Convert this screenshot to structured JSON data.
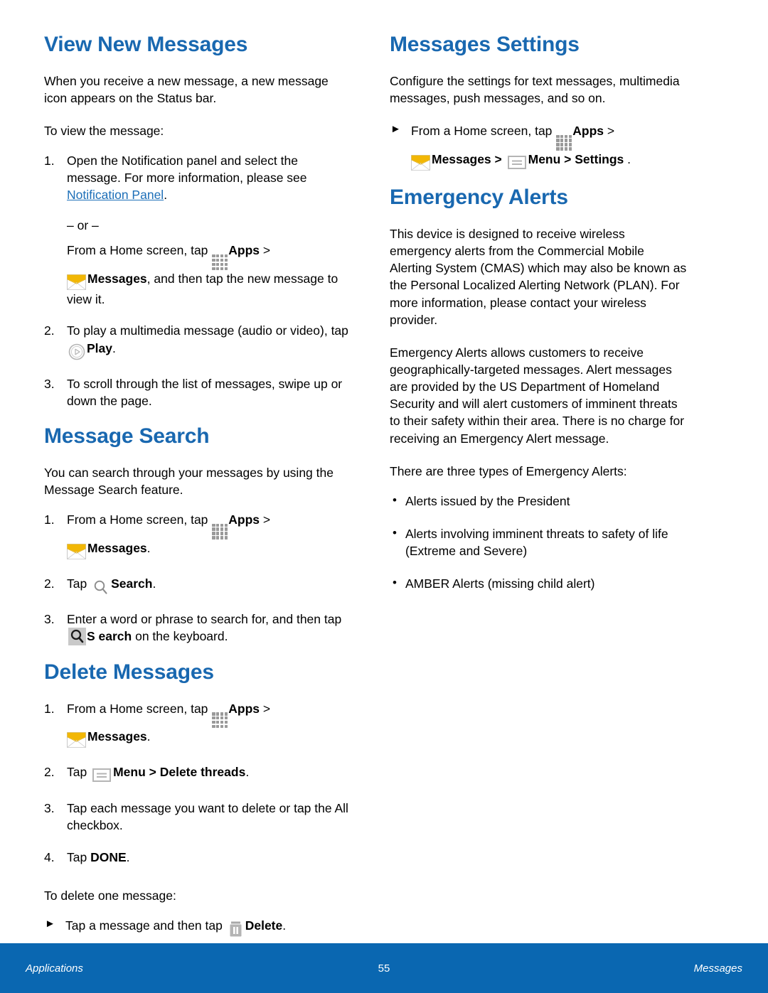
{
  "page": {
    "number": "55",
    "footer_left": "Applications",
    "footer_right": "Messages",
    "heading_color": "#1968b0",
    "footer_color": "#0a67b1",
    "link_color": "#1d6fb8"
  },
  "left_column": {
    "view_new_messages": {
      "heading": "View New Messages",
      "intro": "When you receive a new message, a new message icon appears on the Status bar.",
      "lead_in": "To view the message:",
      "step1_part1": "Open the Notification panel and select the message. For more information, please see ",
      "step1_link": "Notification Panel",
      "step1_period": ".",
      "or_text": "– or –",
      "alt_pre": "From a Home screen, tap ",
      "alt_apps": "Apps",
      "alt_gt": " > ",
      "alt_messages": "Messages",
      "alt_post": ", and then tap the new message to view it.",
      "step2_pre": "To play a multimedia message (audio or video), tap ",
      "step2_play": "Play",
      "step2_post": ".",
      "step3": "To scroll through the list of messages, swipe up or down the page.",
      "numbers": {
        "n1": "1.",
        "n2": "2.",
        "n3": "3."
      }
    },
    "message_search": {
      "heading": "Message Search",
      "intro": "You can search through your messages by using the Message Search feature.",
      "step1_pre": "From a Home screen, tap ",
      "step1_apps": "Apps",
      "step1_gt": " > ",
      "step1_messages": "Messages",
      "step1_post": ".",
      "step2_pre": "Tap ",
      "step2_search": "Search",
      "step2_post": ".",
      "step3_pre": " Enter a word or phrase to search for, and then tap ",
      "step3_search": "S earch",
      "step3_post": " on the keyboard.",
      "numbers": {
        "n1": "1.",
        "n2": "2.",
        "n3": "3."
      }
    },
    "delete_messages": {
      "heading": "Delete Messages",
      "step1_pre": "From a Home screen, tap ",
      "step1_apps": "Apps",
      "step1_gt": " > ",
      "step1_messages": "Messages",
      "step1_post": ".",
      "step2_pre": "Tap ",
      "step2_menu": "Menu > Delete threads",
      "step2_post": ".",
      "step3": "Tap each message you want to delete or tap the All checkbox.",
      "step4_pre": "Tap ",
      "step4_done": "DONE",
      "step4_post": ".",
      "numbers": {
        "n1": "1.",
        "n2": "2.",
        "n3": "3.",
        "n4": "4."
      },
      "one_message_lead": "To delete one message:",
      "one_message_pre": "Tap a message and then tap ",
      "one_message_delete": "Delete",
      "one_message_post": "."
    }
  },
  "right_column": {
    "messages_settings": {
      "heading": "Messages Settings",
      "intro": "Configure the settings for text messages, multimedia messages, push messages, and so on.",
      "step_pre": "From a Home screen, tap ",
      "step_apps": "Apps",
      "step_gt1": " > ",
      "step_messages": "Messages",
      "step_gt2": "  >  ",
      "step_menu": "Menu > Settings",
      "step_post": " ."
    },
    "emergency_alerts": {
      "heading": "Emergency Alerts",
      "para1": "This device is designed to receive wireless emergency alerts from the Commercial Mobile Alerting System (CMAS) which may also be known as the Personal Localized Alerting Network (PLAN). For more information, please contact your wireless provider.",
      "para2": "Emergency Alerts allows customers to receive geographically-targeted messages. Alert messages are provided by the US Department of Homeland Security and will alert customers of imminent threats to their safety within their area. There is no charge for receiving an Emergency Alert message.",
      "lead_in": "There are three types of Emergency Alerts:",
      "bullets": [
        "Alerts issued by the President",
        "Alerts involving imminent threats to safety of life (Extreme and Severe)",
        "AMBER Alerts (missing child alert)"
      ],
      "bullet_glyph": "•"
    }
  },
  "icons": {
    "apps": "apps-grid-icon",
    "messages": "envelope-icon",
    "play": "play-circle-icon",
    "search": "magnifier-icon",
    "menu": "menu-list-icon",
    "trash": "trash-icon",
    "arrow": "►"
  }
}
